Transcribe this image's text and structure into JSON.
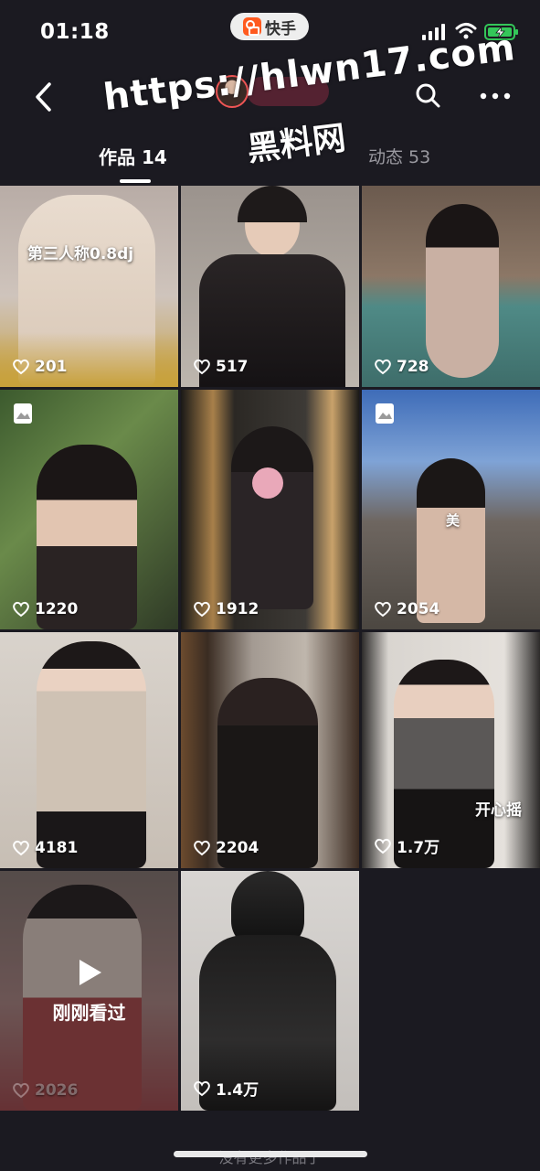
{
  "status_bar": {
    "time": "01:18",
    "app_name": "快手",
    "icons": [
      "signal-icon",
      "wifi-icon",
      "battery-charging-icon"
    ],
    "battery_color": "#34c759"
  },
  "header": {
    "watermark_url": "https://hlwn17.com",
    "watermark_cn": "黑料网",
    "tabs": [
      {
        "label": "作品 14",
        "active": true
      },
      {
        "label": "动态 53",
        "active": false
      }
    ],
    "icons": [
      "back-icon",
      "search-icon",
      "more-icon"
    ]
  },
  "works": [
    {
      "likes": "201",
      "caption": "第三人称0.8dj",
      "badge": false
    },
    {
      "likes": "517",
      "caption": "",
      "badge": false
    },
    {
      "likes": "728",
      "caption": "",
      "badge": false
    },
    {
      "likes": "1220",
      "caption": "",
      "badge": true
    },
    {
      "likes": "1912",
      "caption": "",
      "badge": false
    },
    {
      "likes": "2054",
      "caption": "美",
      "badge": true
    },
    {
      "likes": "4181",
      "caption": "",
      "badge": false
    },
    {
      "likes": "2204",
      "caption": "",
      "badge": false
    },
    {
      "likes": "1.7万",
      "caption": "开心摇",
      "badge": false
    },
    {
      "likes": "2026",
      "caption": "",
      "badge": false,
      "recently_viewed": "刚刚看过"
    },
    {
      "likes": "1.4万",
      "caption": "",
      "badge": false
    }
  ],
  "footer": {
    "no_more_text": "没有更多作品了"
  },
  "colors": {
    "background": "#1b1a21",
    "tab_inactive": "#9a99a0",
    "brand": "#ff5a1f"
  }
}
